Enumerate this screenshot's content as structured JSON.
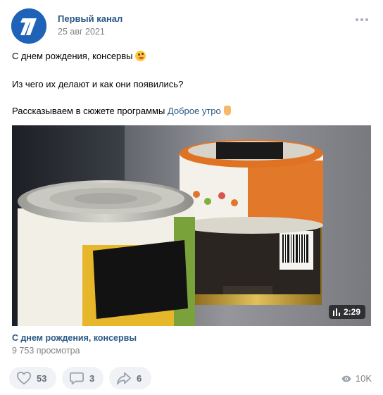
{
  "post": {
    "author": "Первый канал",
    "date": "25 авг 2021",
    "line1": "С днем рождения, консервы",
    "line2": "Из чего их делают и как они появились?",
    "line3_prefix": "Рассказываем в сюжете программы ",
    "line3_link": "Доброе утро"
  },
  "video": {
    "duration": "2:29",
    "title": "С днем рождения, консервы",
    "views": "9 753 просмотра"
  },
  "actions": {
    "likes": "53",
    "comments": "3",
    "shares": "6",
    "views": "10K"
  },
  "icons": {
    "avatar": "channel-one-logo-icon",
    "more": "more-dots-icon",
    "like": "heart-icon",
    "comment": "comment-icon",
    "share": "share-arrow-icon",
    "views": "eye-icon",
    "duration": "bar-chart-icon"
  },
  "colors": {
    "brand_blue": "#1f63b8",
    "link": "#2a5885",
    "muted": "#828282",
    "button_bg": "#f0f2f5"
  }
}
